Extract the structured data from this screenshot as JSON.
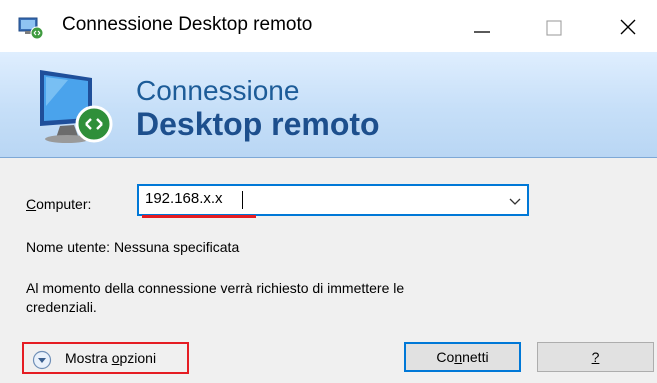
{
  "window": {
    "title": "Connessione Desktop remoto",
    "minimize_glyph": "—",
    "maximize_glyph": "☐",
    "close_glyph": "✕"
  },
  "banner": {
    "line1": "Connessione",
    "line2": "Desktop remoto",
    "icon": "remote-desktop-computer-icon"
  },
  "form": {
    "computer_label_first": "C",
    "computer_label_rest": "omputer:",
    "computer_value": "192.168.x.x",
    "username_line": "Nome utente:  Nessuna specificata",
    "info_line1": "Al momento della connessione verrà richiesto di immettere le",
    "info_line2": "credenziali."
  },
  "buttons": {
    "options_prefix": "Mostra ",
    "options_underlined": "o",
    "options_suffix": "pzioni",
    "connect_prefix": "Co",
    "connect_underlined": "n",
    "connect_suffix": "netti",
    "help_label": "?"
  },
  "colors": {
    "accent": "#0078d7",
    "highlight": "#e51c23",
    "banner_text": "#1d5c98"
  }
}
